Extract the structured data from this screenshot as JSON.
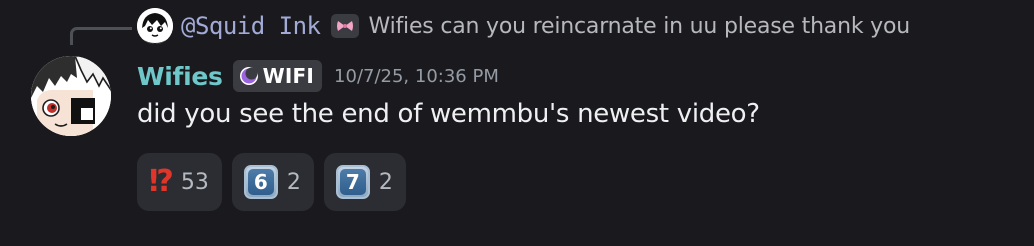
{
  "reply": {
    "author": "@Squid Ink",
    "tag_icon": "bow-icon",
    "text": "Wifies can you reincarnate in uu please thank you"
  },
  "message": {
    "username": "Wifies",
    "username_color": "#6fc7c9",
    "role_icon": "moon-icon",
    "role_label": "WIFI",
    "timestamp": "10/7/25, 10:36 PM",
    "content": "did you see the end of wemmbu's newest video?"
  },
  "reactions": [
    {
      "emoji": "⁉",
      "emoji_name": "interrobang-emoji",
      "count": "53"
    },
    {
      "emoji": "6",
      "emoji_name": "keycap-six-emoji",
      "count": "2"
    },
    {
      "emoji": "7",
      "emoji_name": "keycap-seven-emoji",
      "count": "2"
    }
  ],
  "colors": {
    "background": "#1a1a1e",
    "reaction_bg": "#2c2d32",
    "badge_bg": "#3b3c42",
    "reply_author": "#a2abd6",
    "timestamp": "#949ba4"
  }
}
